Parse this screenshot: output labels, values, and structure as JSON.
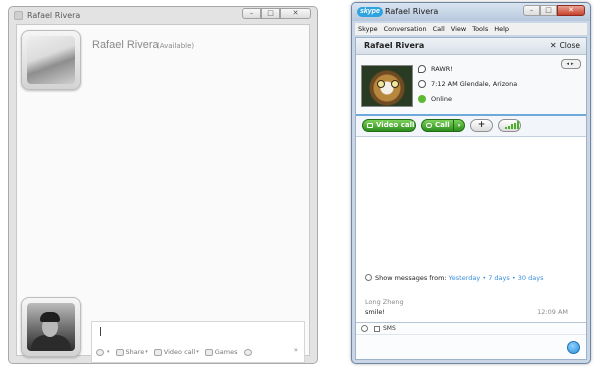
{
  "left_window": {
    "title": "Rafael Rivera",
    "contact_name": "Rafael Rivera",
    "status": "(Available)",
    "toolbar": {
      "share_label": "Share",
      "video_call_label": "Video call",
      "games_label": "Games",
      "more_label": "»"
    }
  },
  "right_window": {
    "app_logo": "skype",
    "title": "Rafael Rivera",
    "menu": [
      "Skype",
      "Conversation",
      "Call",
      "View",
      "Tools",
      "Help"
    ],
    "header": {
      "contact_name": "Rafael Rivera",
      "close_label": "Close",
      "close_glyph": "✕"
    },
    "profile": {
      "mood": "RAWR!",
      "location": "7:12 AM Glendale, Arizona",
      "status": "Online"
    },
    "buttons": {
      "video_call_label": "Video call",
      "call_label": "Call",
      "add_label": "+"
    },
    "history": {
      "prefix": "Show messages from:",
      "yesterday": "Yesterday",
      "seven_days": "7 days",
      "thirty_days": "30 days",
      "separator": "•"
    },
    "message": {
      "sender": "Long Zheng",
      "text": "smile!",
      "time": "12:09 AM"
    },
    "input": {
      "sms_label": "SMS"
    },
    "colors": {
      "call_green": "#2d8f1d",
      "link_blue": "#3b8fd9",
      "online_green": "#5fb832"
    }
  }
}
